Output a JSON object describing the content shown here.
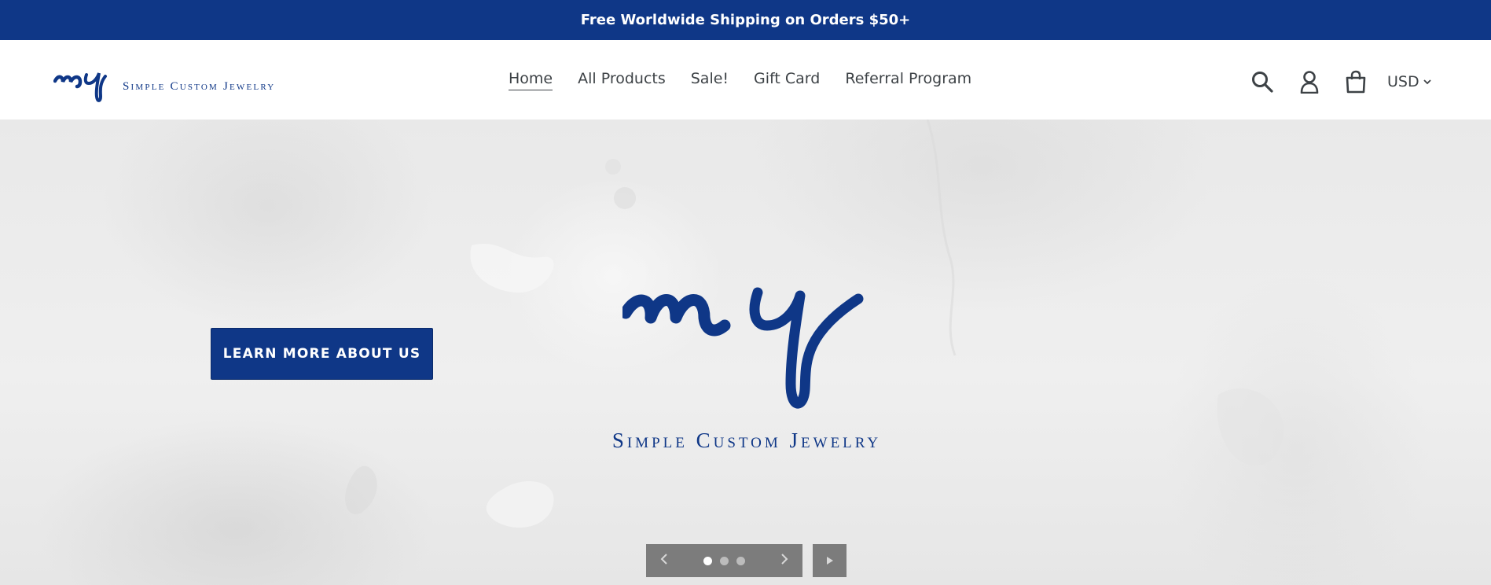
{
  "announcement": {
    "text": "Free Worldwide Shipping on Orders $50+"
  },
  "header": {
    "logo": {
      "monogram": "my",
      "text": "Simple Custom Jewelry"
    },
    "nav": [
      {
        "label": "Home",
        "active": true
      },
      {
        "label": "All Products"
      },
      {
        "label": "Sale!"
      },
      {
        "label": "Gift Card"
      },
      {
        "label": "Referral Program"
      }
    ],
    "icons": [
      "search-icon",
      "account-icon",
      "cart-icon"
    ],
    "currency": "USD"
  },
  "hero": {
    "cta_label": "LEARN MORE ABOUT US",
    "logo_monogram": "my",
    "tagline": "Simple Custom Jewelry",
    "slider": {
      "slides": 3,
      "active_slide": 1
    }
  },
  "colors": {
    "brand": "#0f3787",
    "text": "#3d4246",
    "slider_bg": "#7c7c7c"
  }
}
